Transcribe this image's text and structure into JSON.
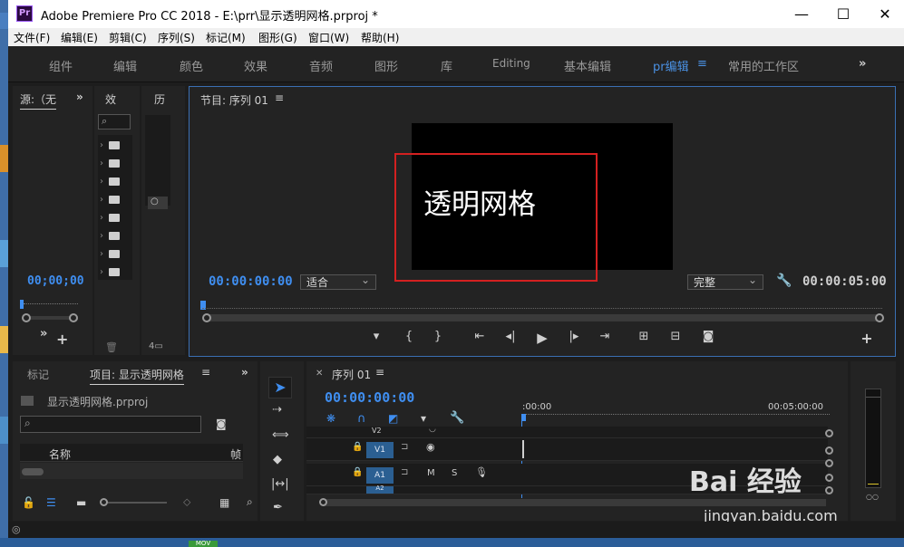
{
  "window": {
    "app_icon_label": "Pr",
    "title": "Adobe Premiere Pro CC 2018 - E:\\prr\\显示透明网格.prproj *",
    "minimize": "—",
    "maximize": "☐",
    "close": "✕"
  },
  "menu": [
    "文件(F)",
    "编辑(E)",
    "剪辑(C)",
    "序列(S)",
    "标记(M)",
    "图形(G)",
    "窗口(W)",
    "帮助(H)"
  ],
  "workspaces": {
    "tabs": [
      "组件",
      "编辑",
      "颜色",
      "效果",
      "音频",
      "图形",
      "库",
      "Editing",
      "基本编辑",
      "pr编辑",
      "常用的工作区"
    ],
    "active": "pr编辑",
    "more": "»"
  },
  "source_panel": {
    "tab": "源:（无",
    "timecode": "00;00;00"
  },
  "effects_panel": {
    "tab": "效"
  },
  "history_panel": {
    "tab": "历"
  },
  "program_monitor": {
    "tab": "节目: 序列 01",
    "menu_icon": "≡",
    "title_text": "透明网格",
    "timecode_left": "00:00:00:00",
    "fit_select": "适合",
    "quality_select": "完整",
    "timecode_right": "00:00:05:00"
  },
  "project_panel": {
    "tab_markers": "标记",
    "tab_project": "项目: 显示透明网格",
    "project_file": "显示透明网格.prproj",
    "column_name": "名称",
    "column_frame": "帧"
  },
  "timeline": {
    "tab": "序列 01",
    "timecode": "00:00:00:00",
    "ruler_start": ":00:00",
    "ruler_end": "00:05:00:00",
    "tracks": [
      {
        "name": "V2"
      },
      {
        "name": "V1"
      },
      {
        "name": "A1"
      },
      {
        "name": "A2"
      }
    ],
    "mute_label": "M",
    "solo_label": "S"
  },
  "watermark": {
    "brand": "Bai 经验",
    "url": "jingyan.baidu.com"
  },
  "desktop": {
    "badge": "MOV"
  },
  "accent_colors": {
    "timecode_blue": "#3f8ef0",
    "highlight_red": "#d32020",
    "track_blue": "#2b5f92"
  }
}
